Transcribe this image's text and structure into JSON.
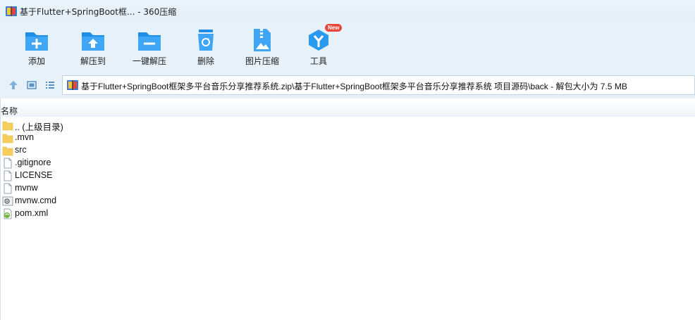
{
  "window": {
    "title": "基于Flutter+SpringBoot框... - 360压缩"
  },
  "toolbar": {
    "items": [
      {
        "label": "添加",
        "icon": "add-icon"
      },
      {
        "label": "解压到",
        "icon": "extract-to-icon"
      },
      {
        "label": "一键解压",
        "icon": "one-click-extract-icon"
      },
      {
        "label": "删除",
        "icon": "delete-icon"
      },
      {
        "label": "图片压缩",
        "icon": "image-compress-icon"
      },
      {
        "label": "工具",
        "icon": "tools-icon",
        "badge": "New"
      }
    ]
  },
  "address": {
    "path": "基于Flutter+SpringBoot框架多平台音乐分享推荐系统.zip\\基于Flutter+SpringBoot框架多平台音乐分享推荐系统 项目源码\\back - 解包大小为 7.5 MB"
  },
  "columns": {
    "name": "名称"
  },
  "files": [
    {
      "name": ".. (上级目录)",
      "type": "folder"
    },
    {
      "name": ".mvn",
      "type": "folder"
    },
    {
      "name": "src",
      "type": "folder"
    },
    {
      "name": ".gitignore",
      "type": "file"
    },
    {
      "name": "LICENSE",
      "type": "file"
    },
    {
      "name": "mvnw",
      "type": "file"
    },
    {
      "name": "mvnw.cmd",
      "type": "cmd"
    },
    {
      "name": "pom.xml",
      "type": "xml"
    }
  ],
  "colors": {
    "accent": "#1e8ee8",
    "badge": "#e8443b",
    "folder": "#f6cf5a"
  }
}
